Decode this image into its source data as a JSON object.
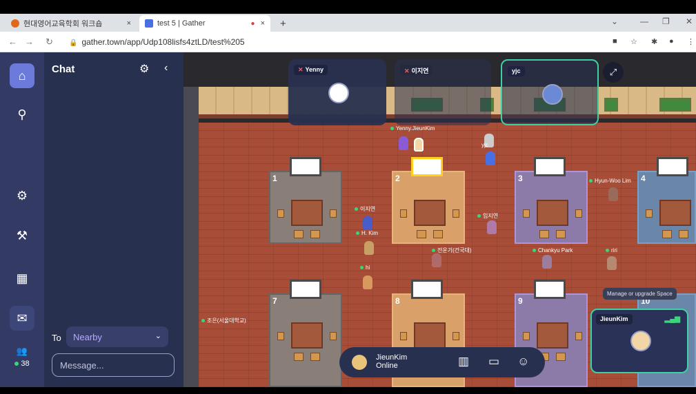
{
  "browser": {
    "tabs": [
      {
        "title": "현대영어교육학회 워크숍",
        "close": "×"
      },
      {
        "title": "test 5 | Gather",
        "close": "×"
      }
    ],
    "new_tab": "+",
    "url": "gather.town/app/Udp108lisfs4ztLD/test%205"
  },
  "sidebar": {
    "chat_title": "Chat",
    "to_label": "To",
    "to_value": "Nearby",
    "message_placeholder": "Message...",
    "online_count": "38"
  },
  "map": {
    "rooms": [
      "1",
      "2",
      "3",
      "4",
      "7",
      "8",
      "9",
      "10"
    ],
    "name_tags": [
      "Yenny.JieunKim",
      "yjc",
      "Hyun-Woo Lim",
      "이지연",
      "임지연",
      "H. Kim",
      "전운기(건국대)",
      "Chankyu Park",
      "riri",
      "hi",
      "조은(서울대학교)"
    ]
  },
  "video_tiles": [
    {
      "name": "Yenny"
    },
    {
      "name": "이지연"
    },
    {
      "name": "yjc"
    }
  ],
  "tooltip": "Manage or upgrade Space",
  "self_tile": {
    "name": "JieunKim"
  },
  "bottom_bar": {
    "name": "JieunKim",
    "status": "Online"
  }
}
